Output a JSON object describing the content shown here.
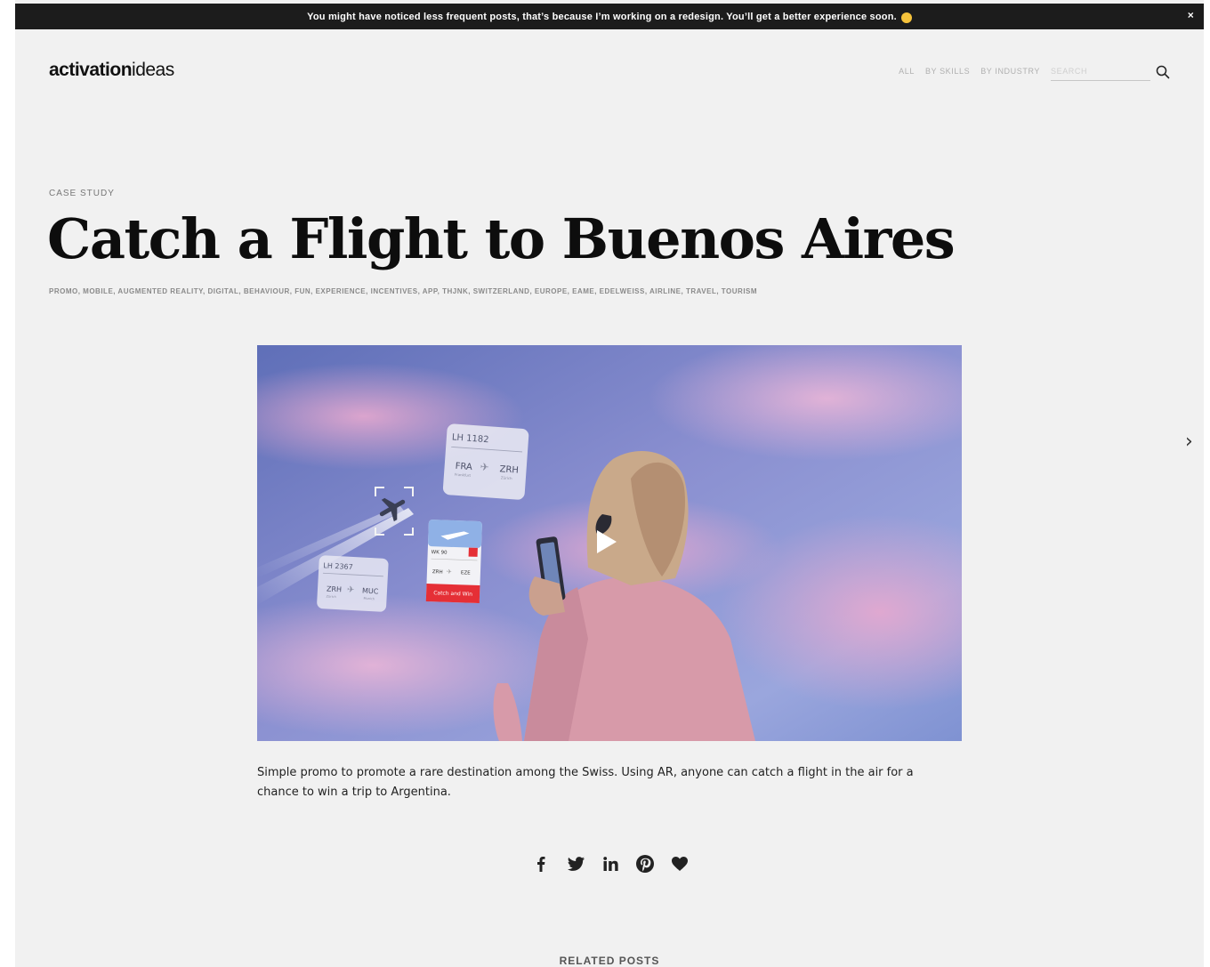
{
  "banner": {
    "message": "You might have noticed less frequent posts, that’s because I’m working on a redesign. You’ll get a better experience soon.",
    "close_label": "×"
  },
  "logo": {
    "bold": "activation",
    "light": "ideas"
  },
  "nav": {
    "items": [
      "ALL",
      "BY SKILLS",
      "BY INDUSTRY"
    ],
    "search_placeholder": "SEARCH",
    "search_value": ""
  },
  "post": {
    "kicker": "CASE STUDY",
    "title": "Catch a Flight to Buenos Aires",
    "tags": "PROMO, MOBILE, AUGMENTED REALITY, DIGITAL, BEHAVIOUR, FUN, EXPERIENCE, INCENTIVES, APP, THJNK, SWITZERLAND, EUROPE, EAME, EDELWEISS, AIRLINE, TRAVEL, TOURISM",
    "description": "Simple promo to promote a rare destination among the Swiss. Using AR, anyone can catch a flight in the air for a chance to win a trip to Argentina.",
    "video_cards": [
      {
        "flight": "LH 1182",
        "from": "FRA",
        "from_sub": "Frankfurt",
        "to": "ZRH",
        "to_sub": "Zürich"
      },
      {
        "flight": "LH 2367",
        "from": "ZRH",
        "from_sub": "Zürich",
        "to": "MUC",
        "to_sub": "Munich"
      },
      {
        "flight": "WK 90",
        "from": "ZRH",
        "to": "EZE",
        "button": "Catch and Win"
      }
    ]
  },
  "next_label": "›",
  "share": {
    "icons": [
      "facebook-icon",
      "twitter-icon",
      "linkedin-icon",
      "pinterest-icon",
      "heart-icon"
    ]
  },
  "related": {
    "heading": "RELATED POSTS"
  },
  "colors": {
    "page_bg": "#f1f1f1",
    "banner_bg": "#1c1c1c",
    "accent_red": "#e52f36"
  }
}
